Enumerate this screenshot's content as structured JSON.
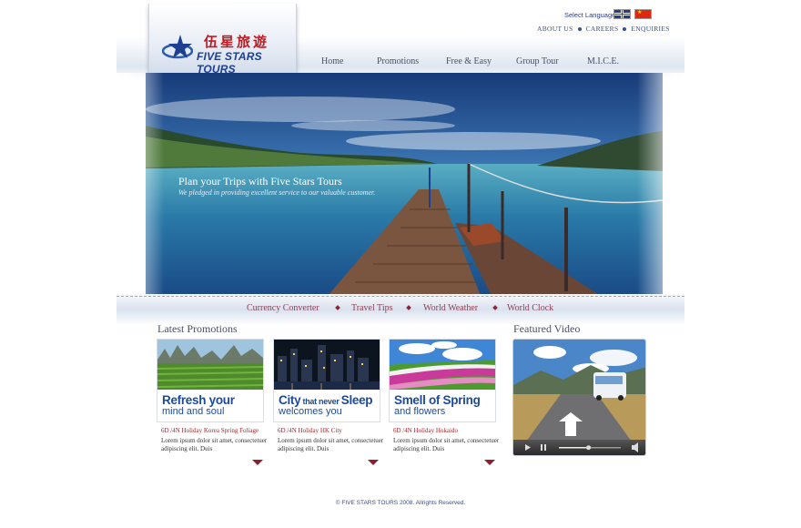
{
  "brand": {
    "name_cn": "伍星旅遊",
    "name_en": "FIVE STARS TOURS"
  },
  "language": {
    "label": "Select Language",
    "options": [
      "English",
      "Chinese"
    ]
  },
  "top_links": [
    "ABOUT US",
    "CAREERS",
    "ENQUIRIES"
  ],
  "nav": [
    "Home",
    "Promotions",
    "Free & Easy",
    "Group Tour",
    "M.I.C.E."
  ],
  "hero": {
    "title": "Plan your Trips with Five Stars Tours",
    "subtitle": "We pledged in providing excellent service to our valuable customer."
  },
  "sub_links": [
    "Currency Converter",
    "Travel Tips",
    "World Weather",
    "World Clock"
  ],
  "promotions": {
    "heading": "Latest Promotions",
    "items": [
      {
        "big": "Refresh your",
        "small": "mind and soul",
        "meta": "6D /4N Holiday Korea Spring Foliage",
        "desc": "Lorem ipsum dolor sit amet, consectetuer adipiscing elit. Duis"
      },
      {
        "big_a": "City",
        "big_b": " that never ",
        "big_c": "Sleep",
        "small": "welcomes you",
        "meta": "6D /4N Holiday HK City",
        "desc": "Lorem ipsum dolor sit amet, consectetuer adipiscing elit. Duis"
      },
      {
        "big": "Smell of Spring",
        "small": "and flowers",
        "meta": "6D /4N Holiday Hokaido",
        "desc": "Lorem ipsum dolor sit amet, consectetuer adipiscing elit. Duis"
      }
    ]
  },
  "video": {
    "heading": "Featured Video",
    "progress": 0.48
  },
  "footer": "© FIVE STARS TOURS 2008. Allrights Reserved.",
  "colors": {
    "brand_blue": "#1d4a9a",
    "accent_red": "#a3282f",
    "nav_text": "#4a5068"
  }
}
